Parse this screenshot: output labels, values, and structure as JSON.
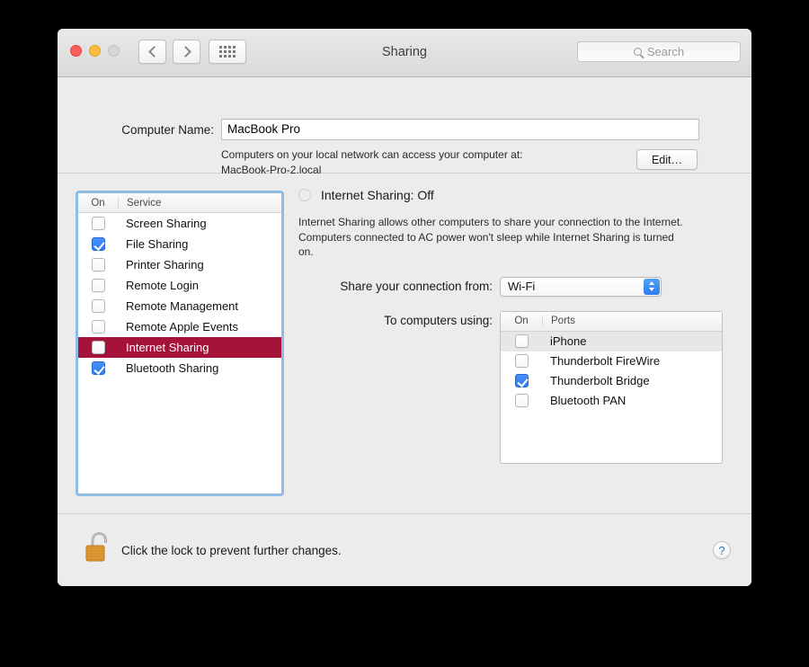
{
  "window": {
    "title": "Sharing",
    "traffic_lights": [
      "close",
      "minimize",
      "zoom"
    ],
    "nav": {
      "back_label": "Back",
      "forward_label": "Forward",
      "grid_label": "Show All"
    },
    "search": {
      "placeholder": "Search",
      "icon": "search-icon",
      "value": ""
    }
  },
  "computer_name": {
    "label": "Computer Name:",
    "value": "MacBook Pro",
    "placeholder": "Computer Name",
    "description_line1": "Computers on your local network can access your computer at:",
    "description_line2": "MacBook-Pro-2.local",
    "edit_button": "Edit…"
  },
  "service_list": {
    "headers": {
      "on": "On",
      "service": "Service"
    },
    "rows": [
      {
        "label": "Screen Sharing",
        "checked": false,
        "selected": false
      },
      {
        "label": "File Sharing",
        "checked": true,
        "selected": false
      },
      {
        "label": "Printer Sharing",
        "checked": false,
        "selected": false
      },
      {
        "label": "Remote Login",
        "checked": false,
        "selected": false
      },
      {
        "label": "Remote Management",
        "checked": false,
        "selected": false
      },
      {
        "label": "Remote Apple Events",
        "checked": false,
        "selected": false
      },
      {
        "label": "Internet Sharing",
        "checked": false,
        "selected": true
      },
      {
        "label": "Bluetooth Sharing",
        "checked": true,
        "selected": false
      }
    ]
  },
  "detail": {
    "status": "Internet Sharing: Off",
    "status_checkbox_state": "off",
    "description": "Internet Sharing allows other computers to share your connection to the Internet. Computers connected to AC power won't sleep while Internet Sharing is turned on.",
    "share_from_label": "Share your connection from:",
    "share_from_value": "Wi-Fi",
    "to_computers_label": "To computers using:",
    "ports": {
      "headers": {
        "on": "On",
        "ports": "Ports"
      },
      "rows": [
        {
          "label": "iPhone",
          "checked": false
        },
        {
          "label": "Thunderbolt FireWire",
          "checked": false
        },
        {
          "label": "Thunderbolt Bridge",
          "checked": true
        },
        {
          "label": "Bluetooth PAN",
          "checked": false
        }
      ]
    }
  },
  "lock_bar": {
    "icon": "unlocked-padlock-icon",
    "text": "Click the lock to prevent further changes.",
    "help_label": "?"
  },
  "colors": {
    "selection": "#a5123a",
    "checkbox_on": "#2e7df0",
    "focus_ring": "#90bce6",
    "window_bg": "#ececec",
    "accent_blue": "#2f6fd0"
  }
}
